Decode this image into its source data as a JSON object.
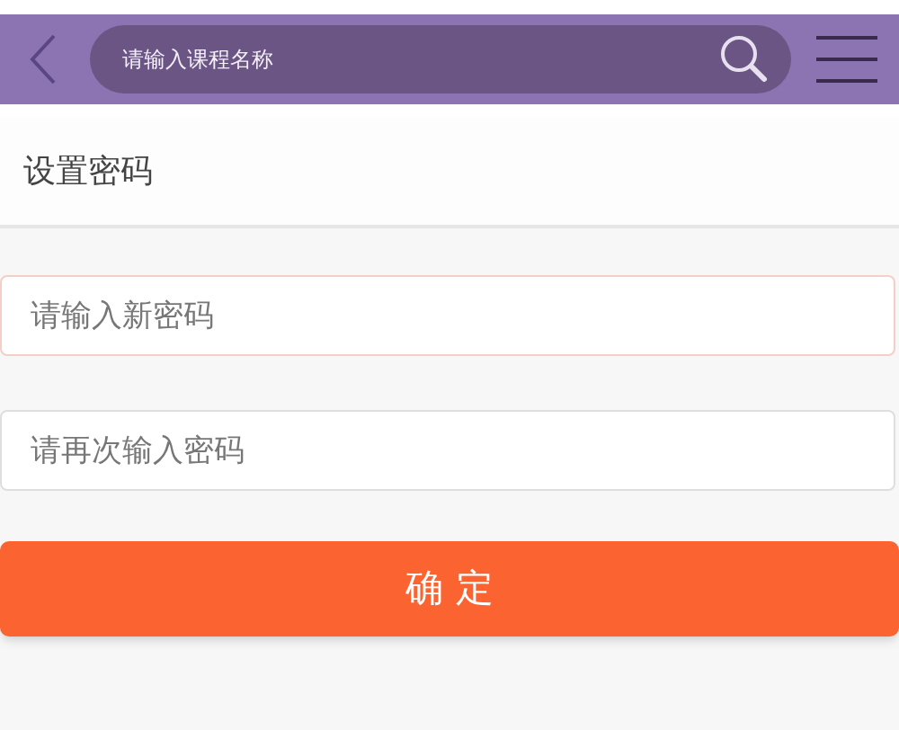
{
  "header": {
    "search": {
      "placeholder": "请输入课程名称"
    }
  },
  "section": {
    "title": "设置密码"
  },
  "fields": [
    {
      "placeholder": "请输入新密码",
      "focused": true
    },
    {
      "placeholder": "请再次输入密码",
      "focused": false
    }
  ],
  "submit": {
    "label": "确 定"
  }
}
